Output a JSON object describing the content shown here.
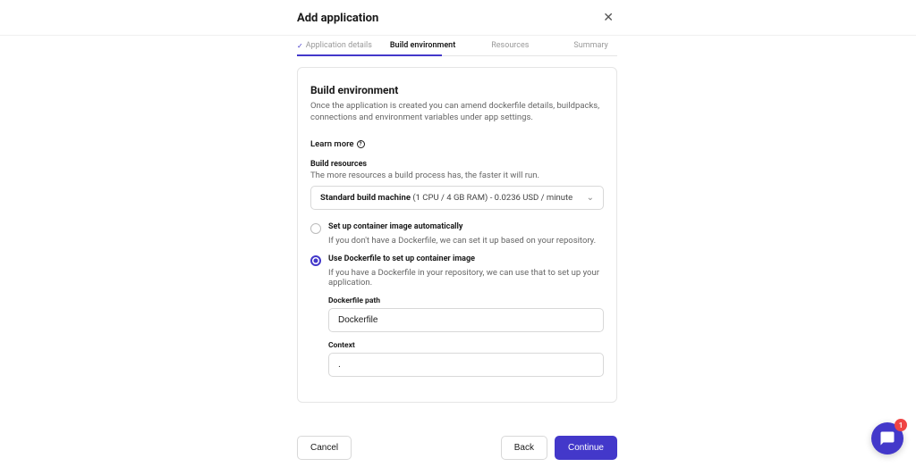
{
  "modal": {
    "title": "Add application"
  },
  "steps": [
    {
      "label": "Application details"
    },
    {
      "label": "Build environment"
    },
    {
      "label": "Resources"
    },
    {
      "label": "Summary"
    }
  ],
  "section": {
    "title": "Build environment",
    "desc": "Once the application is created you can amend dockerfile details, buildpacks, connections and environment variables under app settings.",
    "learn_more": "Learn more"
  },
  "build_resources": {
    "heading": "Build resources",
    "desc": "The more resources a build process has, the faster it will run.",
    "machine_name": "Standard build machine",
    "machine_detail": "(1 CPU / 4 GB RAM) - 0.0236 USD / minute"
  },
  "options": {
    "auto": {
      "label": "Set up container image automatically",
      "desc": "If you don't have a Dockerfile, we can set it up based on your repository."
    },
    "dockerfile": {
      "label": "Use Dockerfile to set up container image",
      "desc": "If you have a Dockerfile in your repository, we can use that to set up your application.",
      "path_label": "Dockerfile path",
      "path_value": "Dockerfile",
      "context_label": "Context",
      "context_value": "."
    }
  },
  "buttons": {
    "cancel": "Cancel",
    "back": "Back",
    "continue": "Continue"
  },
  "chat": {
    "badge": "1"
  }
}
